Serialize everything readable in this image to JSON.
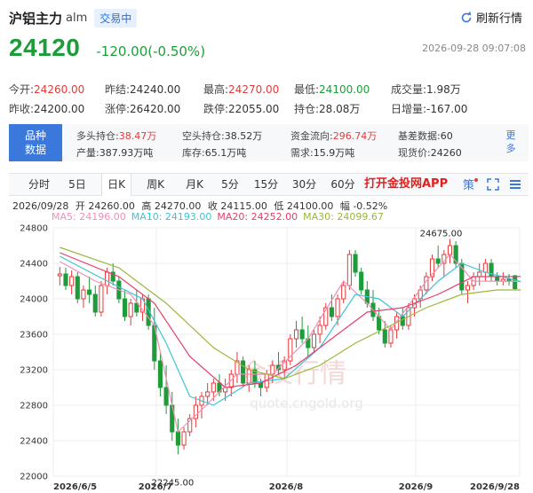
{
  "header": {
    "name": "沪铝主力",
    "code": "alm",
    "status": "交易中",
    "refresh_label": "刷新行情"
  },
  "quote": {
    "price": "24120",
    "change": "-120.00(-0.50%)",
    "timestamp": "2026-09-28 09:07:08"
  },
  "stats": {
    "row1": [
      {
        "label": "今开:",
        "value": "24260.00",
        "color": "red"
      },
      {
        "label": "昨结:",
        "value": "24240.00",
        "color": ""
      },
      {
        "label": "最高:",
        "value": "24270.00",
        "color": "red"
      },
      {
        "label": "最低:",
        "value": "24100.00",
        "color": "green"
      },
      {
        "label": "成交量:",
        "value": "1.98万",
        "color": ""
      }
    ],
    "row2": [
      {
        "label": "昨收:",
        "value": "24200.00",
        "color": ""
      },
      {
        "label": "涨停:",
        "value": "26420.00",
        "color": ""
      },
      {
        "label": "跌停:",
        "value": "22055.00",
        "color": ""
      },
      {
        "label": "持仓:",
        "value": "28.08万",
        "color": ""
      },
      {
        "label": "日增量:",
        "value": "-167.00",
        "color": ""
      }
    ]
  },
  "info": {
    "tag_line1": "品种",
    "tag_line2": "数据",
    "row1": [
      {
        "label": "多头持仓:",
        "value": "38.47万",
        "color": "red"
      },
      {
        "label": "空头持仓:",
        "value": "38.52万",
        "color": ""
      },
      {
        "label": "资金流向:",
        "value": "296.74万",
        "color": "red"
      },
      {
        "label": "基差数据:",
        "value": "60",
        "color": ""
      }
    ],
    "row2": [
      {
        "label": "产量:",
        "value": "387.93万吨",
        "color": ""
      },
      {
        "label": "库存:",
        "value": "65.1万吨",
        "color": ""
      },
      {
        "label": "需求:",
        "value": "15.9万吨",
        "color": ""
      },
      {
        "label": "现货价:",
        "value": "24260",
        "color": ""
      }
    ],
    "more_line1": "更",
    "more_line2": "多"
  },
  "tabs": [
    "分时",
    "5日",
    "日K",
    "周K",
    "月K",
    "5分",
    "15分",
    "30分",
    "60分"
  ],
  "active_tab": "日K",
  "app_link": "打开金投网APP",
  "toolbar_icons": [
    "strategy-icon",
    "fullscreen-icon",
    "settings-icon"
  ],
  "legend": {
    "date": "2026/09/28",
    "open": "开 24260.00",
    "high": "高 24270.00",
    "close": "收 24115.00",
    "low": "低 24100.00",
    "pct": "幅 -0.52%",
    "ma": [
      {
        "label": "MA5: 24196.00",
        "color": "#f08fb8"
      },
      {
        "label": "MA10: 24193.00",
        "color": "#3ec3d8"
      },
      {
        "label": "MA20: 24252.00",
        "color": "#e83e6a"
      },
      {
        "label": "MA30: 24099.67",
        "color": "#9ab83a"
      }
    ]
  },
  "watermark": {
    "text": "金投行情",
    "url": "quote.cngold.org"
  },
  "colors": {
    "up": "#e23b3b",
    "down": "#1e9c3a",
    "accent": "#3b78dc"
  },
  "chart_data": {
    "type": "candlestick",
    "ylim": [
      22000,
      24800
    ],
    "yticks": [
      24800,
      24400,
      24000,
      23600,
      23200,
      22800,
      22400,
      22000
    ],
    "xtick_labels": [
      "2026/6/5",
      "2026/7",
      "2026/8",
      "2026/9",
      "2026/9/28"
    ],
    "annotations": [
      {
        "text": "24675.00",
        "value": 24675
      },
      {
        "text": "22245.00",
        "value": 22245
      }
    ],
    "candles": [
      [
        24260,
        24360,
        24150,
        24280
      ],
      [
        24280,
        24350,
        24100,
        24150
      ],
      [
        24150,
        24320,
        24050,
        24250
      ],
      [
        24250,
        24300,
        23950,
        24000
      ],
      [
        24000,
        24150,
        23900,
        24100
      ],
      [
        24100,
        24250,
        23950,
        24050
      ],
      [
        24050,
        24150,
        23800,
        23850
      ],
      [
        23850,
        24200,
        23800,
        24150
      ],
      [
        24150,
        24350,
        24050,
        24300
      ],
      [
        24300,
        24400,
        24150,
        24200
      ],
      [
        24200,
        24250,
        23950,
        24000
      ],
      [
        24000,
        24100,
        23750,
        23800
      ],
      [
        23800,
        24000,
        23700,
        23950
      ],
      [
        23950,
        24100,
        23800,
        23850
      ],
      [
        23850,
        24050,
        23750,
        24000
      ],
      [
        24000,
        24050,
        23650,
        23700
      ],
      [
        23700,
        23900,
        23200,
        23300
      ],
      [
        23300,
        23400,
        22900,
        23000
      ],
      [
        23000,
        23250,
        22700,
        22800
      ],
      [
        22800,
        22950,
        22400,
        22500
      ],
      [
        22500,
        22650,
        22245,
        22350
      ],
      [
        22350,
        22550,
        22300,
        22500
      ],
      [
        22500,
        22700,
        22450,
        22650
      ],
      [
        22650,
        22900,
        22550,
        22800
      ],
      [
        22800,
        22950,
        22650,
        22900
      ],
      [
        22900,
        23050,
        22800,
        22950
      ],
      [
        22950,
        23100,
        22850,
        23050
      ],
      [
        23050,
        23150,
        22900,
        22950
      ],
      [
        22950,
        23100,
        22850,
        23000
      ],
      [
        23000,
        23200,
        22900,
        23150
      ],
      [
        23150,
        23400,
        23050,
        23300
      ],
      [
        23300,
        23350,
        23000,
        23050
      ],
      [
        23050,
        23250,
        22950,
        23200
      ],
      [
        23200,
        23300,
        23000,
        23050
      ],
      [
        23050,
        23100,
        22900,
        23000
      ],
      [
        23000,
        23200,
        22950,
        23150
      ],
      [
        23150,
        23300,
        23050,
        23250
      ],
      [
        23250,
        23400,
        23150,
        23200
      ],
      [
        23200,
        23350,
        23100,
        23300
      ],
      [
        23300,
        23600,
        23250,
        23550
      ],
      [
        23550,
        23750,
        23450,
        23650
      ],
      [
        23650,
        23800,
        23500,
        23550
      ],
      [
        23550,
        23700,
        23350,
        23450
      ],
      [
        23450,
        23650,
        23400,
        23600
      ],
      [
        23600,
        23800,
        23500,
        23700
      ],
      [
        23700,
        23950,
        23650,
        23900
      ],
      [
        23900,
        24050,
        23750,
        23800
      ],
      [
        23800,
        24050,
        23700,
        24000
      ],
      [
        24000,
        24200,
        23950,
        24150
      ],
      [
        24150,
        24550,
        24100,
        24500
      ],
      [
        24500,
        24550,
        24250,
        24300
      ],
      [
        24300,
        24350,
        24050,
        24100
      ],
      [
        24100,
        24200,
        23900,
        23950
      ],
      [
        23950,
        24100,
        23750,
        23800
      ],
      [
        23800,
        23900,
        23600,
        23650
      ],
      [
        23650,
        23750,
        23450,
        23500
      ],
      [
        23500,
        23700,
        23450,
        23650
      ],
      [
        23650,
        23850,
        23550,
        23800
      ],
      [
        23800,
        23900,
        23650,
        23700
      ],
      [
        23700,
        23950,
        23650,
        23900
      ],
      [
        23900,
        24050,
        23800,
        24000
      ],
      [
        24000,
        24150,
        23900,
        24100
      ],
      [
        24100,
        24300,
        24050,
        24250
      ],
      [
        24250,
        24500,
        24200,
        24450
      ],
      [
        24450,
        24600,
        24350,
        24400
      ],
      [
        24400,
        24550,
        24250,
        24500
      ],
      [
        24500,
        24675,
        24400,
        24600
      ],
      [
        24600,
        24650,
        24350,
        24400
      ],
      [
        24400,
        24450,
        24050,
        24100
      ],
      [
        24100,
        24200,
        23950,
        24150
      ],
      [
        24150,
        24300,
        24100,
        24250
      ],
      [
        24250,
        24400,
        24150,
        24300
      ],
      [
        24300,
        24450,
        24200,
        24400
      ],
      [
        24400,
        24450,
        24200,
        24250
      ],
      [
        24250,
        24300,
        24150,
        24200
      ],
      [
        24200,
        24300,
        24150,
        24220
      ],
      [
        24220,
        24280,
        24150,
        24200
      ],
      [
        24260,
        24270,
        24100,
        24115
      ]
    ],
    "ma_series": [
      {
        "name": "MA5",
        "color": "#f08fb8",
        "values": [
          [
            0,
            24420
          ],
          [
            6,
            24200
          ],
          [
            12,
            24050
          ],
          [
            16,
            23700
          ],
          [
            20,
            22500
          ],
          [
            24,
            22750
          ],
          [
            30,
            23150
          ],
          [
            36,
            23150
          ],
          [
            42,
            23550
          ],
          [
            48,
            24200
          ],
          [
            52,
            23950
          ],
          [
            56,
            23650
          ],
          [
            62,
            24200
          ],
          [
            66,
            24500
          ],
          [
            70,
            24200
          ],
          [
            78,
            24196
          ]
        ]
      },
      {
        "name": "MA10",
        "color": "#3ec3d8",
        "values": [
          [
            0,
            24480
          ],
          [
            8,
            24200
          ],
          [
            14,
            24000
          ],
          [
            18,
            23500
          ],
          [
            22,
            22900
          ],
          [
            26,
            22800
          ],
          [
            32,
            23050
          ],
          [
            38,
            23100
          ],
          [
            44,
            23450
          ],
          [
            50,
            24050
          ],
          [
            54,
            24000
          ],
          [
            58,
            23800
          ],
          [
            64,
            24200
          ],
          [
            68,
            24400
          ],
          [
            72,
            24300
          ],
          [
            78,
            24193
          ]
        ]
      },
      {
        "name": "MA20",
        "color": "#e83e6a",
        "values": [
          [
            0,
            24520
          ],
          [
            10,
            24250
          ],
          [
            16,
            23950
          ],
          [
            22,
            23350
          ],
          [
            28,
            23000
          ],
          [
            34,
            23050
          ],
          [
            40,
            23250
          ],
          [
            46,
            23550
          ],
          [
            52,
            23850
          ],
          [
            58,
            23900
          ],
          [
            64,
            24050
          ],
          [
            70,
            24250
          ],
          [
            78,
            24252
          ]
        ]
      },
      {
        "name": "MA30",
        "color": "#9ab83a",
        "values": [
          [
            0,
            24580
          ],
          [
            10,
            24350
          ],
          [
            18,
            23950
          ],
          [
            26,
            23450
          ],
          [
            32,
            23200
          ],
          [
            38,
            23100
          ],
          [
            44,
            23250
          ],
          [
            50,
            23500
          ],
          [
            56,
            23700
          ],
          [
            62,
            23900
          ],
          [
            68,
            24050
          ],
          [
            74,
            24100
          ],
          [
            78,
            24100
          ]
        ]
      }
    ]
  }
}
